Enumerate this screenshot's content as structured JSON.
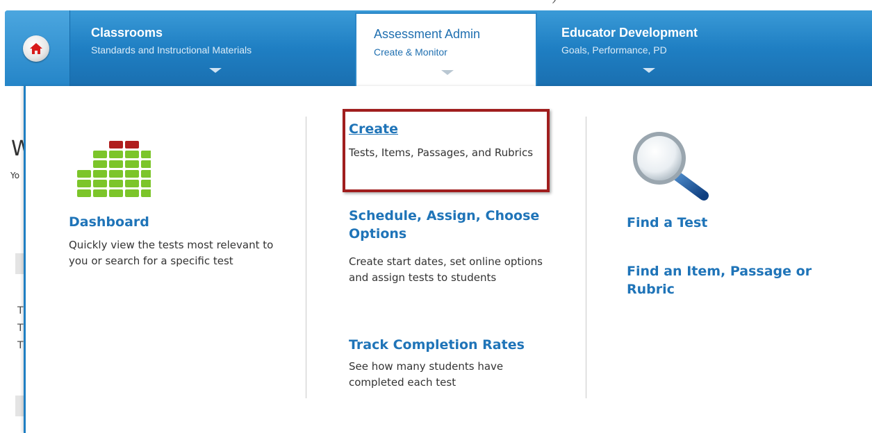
{
  "nav": {
    "home_label": "Home",
    "tabs": [
      {
        "title": "Classrooms",
        "subtitle": "Standards and Instructional Materials"
      },
      {
        "title": "Assessment Admin",
        "subtitle": "Create & Monitor"
      },
      {
        "title": "Educator Development",
        "subtitle": "Goals, Performance, PD"
      }
    ]
  },
  "background_page": {
    "heading_fragment": "W",
    "subtext_fragment": "Yo",
    "list_fragments": [
      "T",
      "T",
      "T"
    ]
  },
  "menu": {
    "dashboard": {
      "title": "Dashboard",
      "description": "Quickly view the tests most relevant to you or search for a specific test",
      "icon": "bar-chart-icon"
    },
    "create": {
      "title": "Create",
      "description": "Tests, Items, Passages, and Rubrics"
    },
    "schedule": {
      "title": "Schedule, Assign, Choose Options",
      "description": "Create start dates, set online options and assign tests to students"
    },
    "track": {
      "title": "Track Completion Rates",
      "description": "See how many students have completed each test"
    },
    "find_test": {
      "title": "Find a Test",
      "icon": "magnifier-icon"
    },
    "find_item": {
      "title": "Find an Item, Passage or Rubric"
    }
  },
  "colors": {
    "nav_blue": "#1f7fc3",
    "link_blue": "#1f74b8",
    "highlight_red": "#a01e1e",
    "chart_green": "#7cc52a",
    "chart_red": "#b01e1e"
  }
}
